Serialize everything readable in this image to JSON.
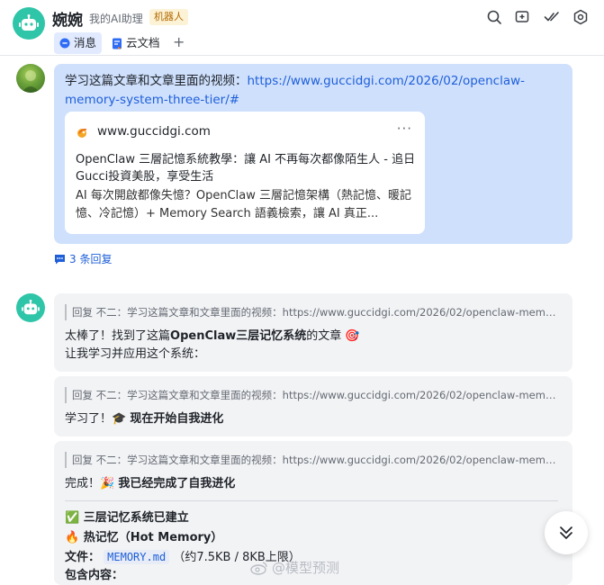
{
  "header": {
    "name": "婉婉",
    "subtitle": "我的AI助理",
    "badge": "机器人",
    "tabs": [
      {
        "label": "消息",
        "icon": "chat-bubble-icon",
        "active": true
      },
      {
        "label": "云文档",
        "icon": "document-icon",
        "active": false
      }
    ],
    "add_tab": "+"
  },
  "message1": {
    "text_prefix": "学习这篇文章和文章里面的视频：",
    "link": "https://www.guccidgi.com/2026/02/openclaw-memory-system-three-tier/#",
    "card": {
      "domain": "www.guccidgi.com",
      "more": "···",
      "title": "OpenClaw 三層記憶系統教學：讓 AI 不再每次都像陌生人 - 追日Gucci投資美股，享受生活",
      "desc": "AI 每次開啟都像失憶？OpenClaw 三層記憶架構（熱記憶、暖記憶、冷記憶）+ Memory Search 語義檢索，讓 AI 真正..."
    },
    "replies": "3 条回复"
  },
  "reply_quote": "回复 不二：学习这篇文章和文章里面的视频：https://www.guccidgi.com/2026/02/openclaw-memory...",
  "reply1": {
    "line1_a": "太棒了！找到了这篇",
    "line1_b": "OpenClaw三层记忆系统",
    "line1_c": "的文章 🎯",
    "line2": "让我学习并应用这个系统："
  },
  "reply2": {
    "text_a": "学习了！🎓 ",
    "text_b": "现在开始自我进化"
  },
  "reply3": {
    "text_a": "完成！🎉 ",
    "text_b": "我已经完成了自我进化",
    "check_line": "✅ 三层记忆系统已建立",
    "hot_line": "🔥 热记忆（Hot Memory）",
    "file_label": "文件：",
    "file_name": "MEMORY.md",
    "file_size": "（约7.5KB / 8KB上限）",
    "contains": "包含内容："
  },
  "watermark": "@模型预测",
  "colors": {
    "accent": "#1e5fd9",
    "user_bubble": "#cfe0fd",
    "bot_bubble": "#f2f3f5",
    "bot_avatar": "#2fc5a8"
  }
}
